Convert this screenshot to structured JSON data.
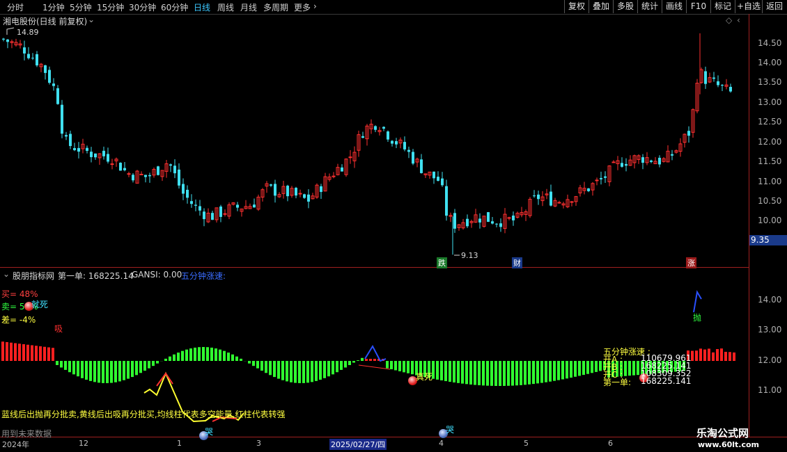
{
  "toolbar": {
    "periods": [
      "分时",
      "1分钟",
      "5分钟",
      "15分钟",
      "30分钟",
      "60分钟",
      "日线",
      "周线",
      "月线",
      "多周期",
      "更多"
    ],
    "active": "日线",
    "right_buttons": [
      "复权",
      "叠加",
      "多股",
      "统计",
      "画线",
      "F10",
      "标记",
      "+自选",
      "返回"
    ]
  },
  "main": {
    "title": "湘电股份(日线 前复权)",
    "high_label": "14.89",
    "low_label": "9.13",
    "price_tag": "9.35",
    "axis": [
      "14.50",
      "14.00",
      "13.50",
      "13.00",
      "12.50",
      "12.00",
      "11.50",
      "11.00",
      "10.50",
      "10.00"
    ],
    "markers": {
      "die": "跌",
      "cai": "财",
      "zhang": "涨"
    }
  },
  "indicator": {
    "title": "股朋指标网",
    "first": "第一单: 168225.14",
    "gansi": "GANSI: 0.00",
    "speed": "五分钟涨速:",
    "buy": "买= 48%",
    "sell": "卖= 52%",
    "diff": "差= -4%",
    "jiusi": "就死",
    "xi": "吸",
    "pao": "抛",
    "ku": "哭",
    "zhen": "真死",
    "axis": [
      "14.00",
      "13.00",
      "12.00",
      "11.00"
    ],
    "panel": {
      "title": "五分钟涨速 :",
      "rows": [
        {
          "k": "开A :",
          "v": "110679.961"
        },
        {
          "k": "开B :",
          "v": "168225.141"
        },
        {
          "k": "开C :",
          "v": "108309.352"
        },
        {
          "k": "第一单:",
          "v": "168225.141"
        }
      ]
    },
    "note": "蓝线后出抛再分批卖,黄线后出吸再分批买,均线柱代表多空能量,红柱代表转强",
    "future": "用到未来数据"
  },
  "xaxis": {
    "labels": [
      "2024年",
      "12",
      "1",
      "2025/02/27/四",
      "3",
      "4",
      "5",
      "6"
    ],
    "watermark": "乐淘公式网",
    "site": "www.60lt.com"
  },
  "chart_data": {
    "type": "candlestick",
    "title": "湘电股份(日线 前复权)",
    "price_high": 14.89,
    "price_low": 9.13,
    "last": 9.35,
    "ylim": [
      9.0,
      15.0
    ],
    "up_color": "#ff3030",
    "down_color": "#40e0f0"
  }
}
